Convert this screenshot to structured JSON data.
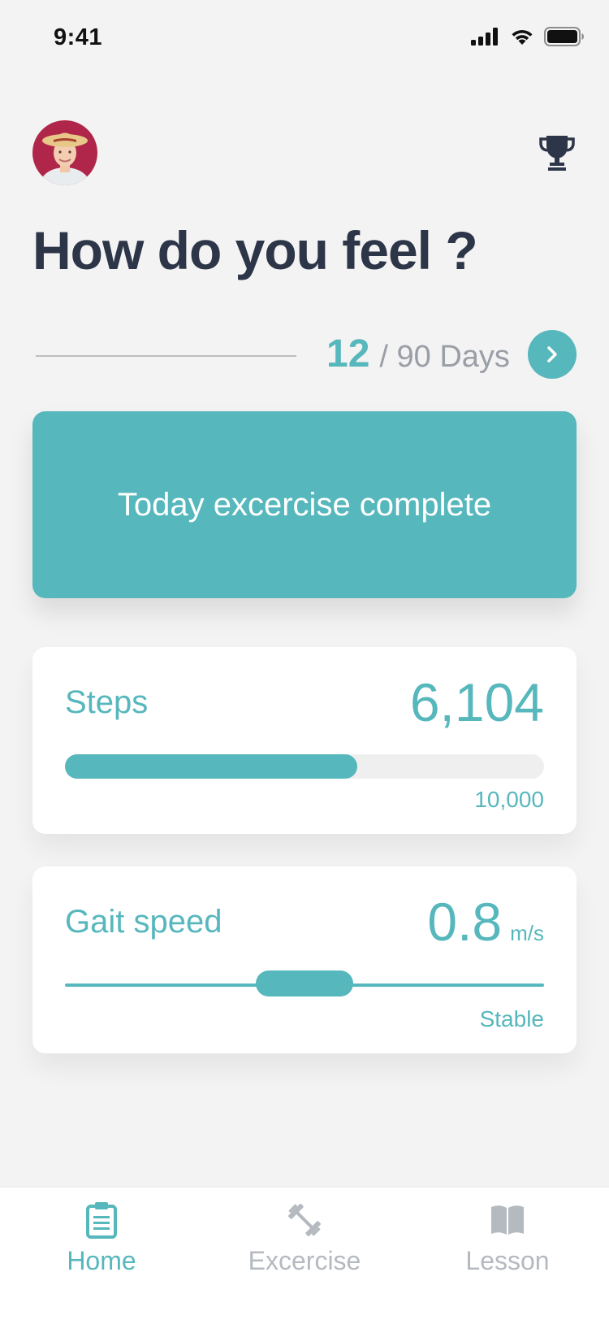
{
  "status_bar": {
    "time": "9:41"
  },
  "header": {
    "avatar_alt": "user avatar",
    "title": "How do you feel ?"
  },
  "progress": {
    "current_day": "12",
    "total_label": "/ 90 Days"
  },
  "banner": {
    "text": "Today excercise complete"
  },
  "steps_card": {
    "label": "Steps",
    "value": "6,104",
    "goal": "10,000",
    "progress_fraction": 0.61
  },
  "gait_card": {
    "label": "Gait speed",
    "value": "0.8",
    "unit": "m/s",
    "status": "Stable",
    "indicator_position": 0.5
  },
  "tabbar": {
    "tabs": [
      {
        "label": "Home",
        "icon": "clipboard-icon",
        "active": true
      },
      {
        "label": "Excercise",
        "icon": "dumbbell-icon",
        "active": false
      },
      {
        "label": "Lesson",
        "icon": "book-icon",
        "active": false
      }
    ]
  },
  "colors": {
    "accent": "#56b7bc",
    "title": "#2d3548",
    "muted": "#9a9ea6",
    "inactive_tab": "#b5b9c0",
    "background": "#f3f3f3"
  }
}
